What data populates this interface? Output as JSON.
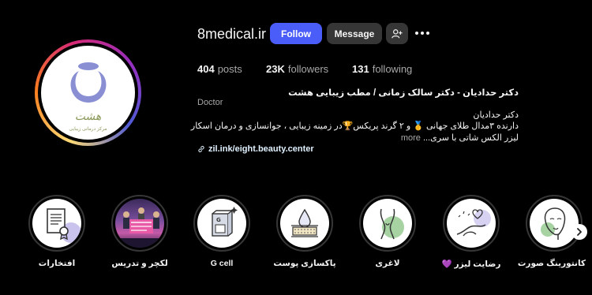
{
  "profile": {
    "username": "8medical.ir",
    "follow_label": "Follow",
    "message_label": "Message",
    "logo_text": "هشت",
    "logo_subtext": "مرکز درمانی زیبایی"
  },
  "stats": {
    "posts_count": "404",
    "posts_label": "posts",
    "followers_count": "23K",
    "followers_label": "followers",
    "following_count": "131",
    "following_label": "following"
  },
  "bio": {
    "name": "دکتر حدادیان - دکتر سالک زمانی / مطب زیبایی هشت",
    "category": "Doctor",
    "line1": "دکتر حدادیان",
    "line2": "دارنده ۳مدال طلای جهانی 🥇 و ۲ گرند پریکس🏆در زمینه زیبایی ، جوانسازی و درمان اسکار",
    "line3": "لیزر الکس شاتی با سری...",
    "more_label": "more",
    "link": "zil.ink/eight.beauty.center"
  },
  "highlights": [
    {
      "label": "افتخارات",
      "icon": "certificate-icon"
    },
    {
      "label": "لکچر و تدریس",
      "icon": "lecture-photo"
    },
    {
      "label": "G cell",
      "icon": "gcell-box-icon"
    },
    {
      "label": "پاکسازی پوست",
      "icon": "skin-cleansing-icon"
    },
    {
      "label": "لاغری",
      "icon": "body-slimming-icon"
    },
    {
      "label": "رضایت لیزر 💜",
      "icon": "laser-satisfaction-icon"
    },
    {
      "label": "کانتورینگ صورت",
      "icon": "face-contouring-icon"
    }
  ],
  "colors": {
    "follow_button": "#4a5df9",
    "secondary_button": "#363636",
    "logo_purple": "#8a8fd4",
    "accent_green": "#a7d3a2"
  }
}
